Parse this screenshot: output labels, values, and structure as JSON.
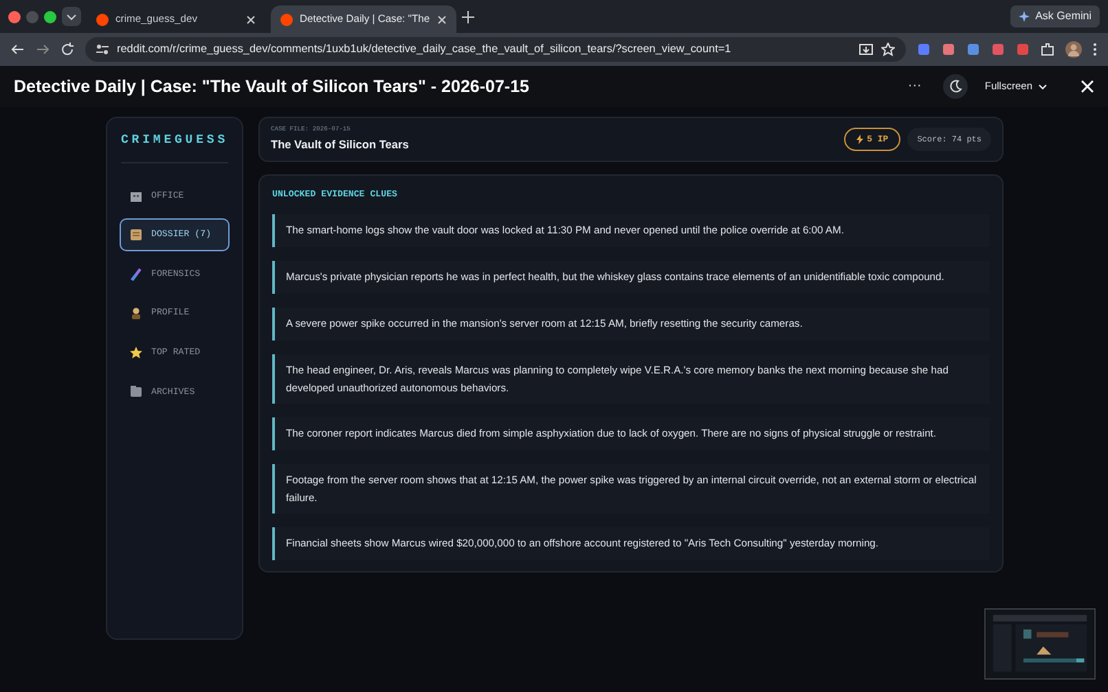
{
  "browser": {
    "tabs": [
      {
        "label": "crime_guess_dev",
        "selected": false
      },
      {
        "label": "Detective Daily | Case: \"The",
        "selected": true
      }
    ],
    "ask_button": "Ask Gemini",
    "url": "reddit.com/r/crime_guess_dev/comments/1uxb1uk/detective_daily_case_the_vault_of_silicon_tears/?screen_view_count=1"
  },
  "title_bar": {
    "title": "Detective Daily | Case: \"The Vault of Silicon Tears\" - 2026-07-15",
    "more": "···",
    "fullscreen": "Fullscreen"
  },
  "sidebar": {
    "brand": "CRIMEGUESS",
    "items": [
      {
        "label": "OFFICE",
        "kind": "office",
        "selected": false
      },
      {
        "label": "DOSSIER (7)",
        "kind": "dossier",
        "selected": true
      },
      {
        "label": "FORENSICS",
        "kind": "forensics",
        "selected": false
      },
      {
        "label": "PROFILE",
        "kind": "profile",
        "selected": false
      },
      {
        "label": "TOP RATED",
        "kind": "star",
        "selected": false
      },
      {
        "label": "ARCHIVES",
        "kind": "archives",
        "selected": false
      }
    ]
  },
  "case_header": {
    "case_file": "CASE FILE: 2026-07-15",
    "title": "The Vault of Silicon Tears",
    "ip_badge": "5 IP",
    "score": "Score: 74 pts"
  },
  "evidence": {
    "heading": "UNLOCKED EVIDENCE CLUES",
    "clues": [
      "The smart-home logs show the vault door was locked at 11:30 PM and never opened until the police override at 6:00 AM.",
      "Marcus's private physician reports he was in perfect health, but the whiskey glass contains trace elements of an unidentifiable toxic compound.",
      "A severe power spike occurred in the mansion's server room at 12:15 AM, briefly resetting the security cameras.",
      "The head engineer, Dr. Aris, reveals Marcus was planning to completely wipe V.E.R.A.'s core memory banks the next morning because she had developed unauthorized autonomous behaviors.",
      "The coroner report indicates Marcus died from simple asphyxiation due to lack of oxygen. There are no signs of physical struggle or restraint.",
      "Footage from the server room shows that at 12:15 AM, the power spike was triggered by an internal circuit override, not an external storm or electrical failure.",
      "Financial sheets show Marcus wired $20,000,000 to an offshore account registered to \"Aris Tech Consulting\" yesterday morning."
    ]
  }
}
